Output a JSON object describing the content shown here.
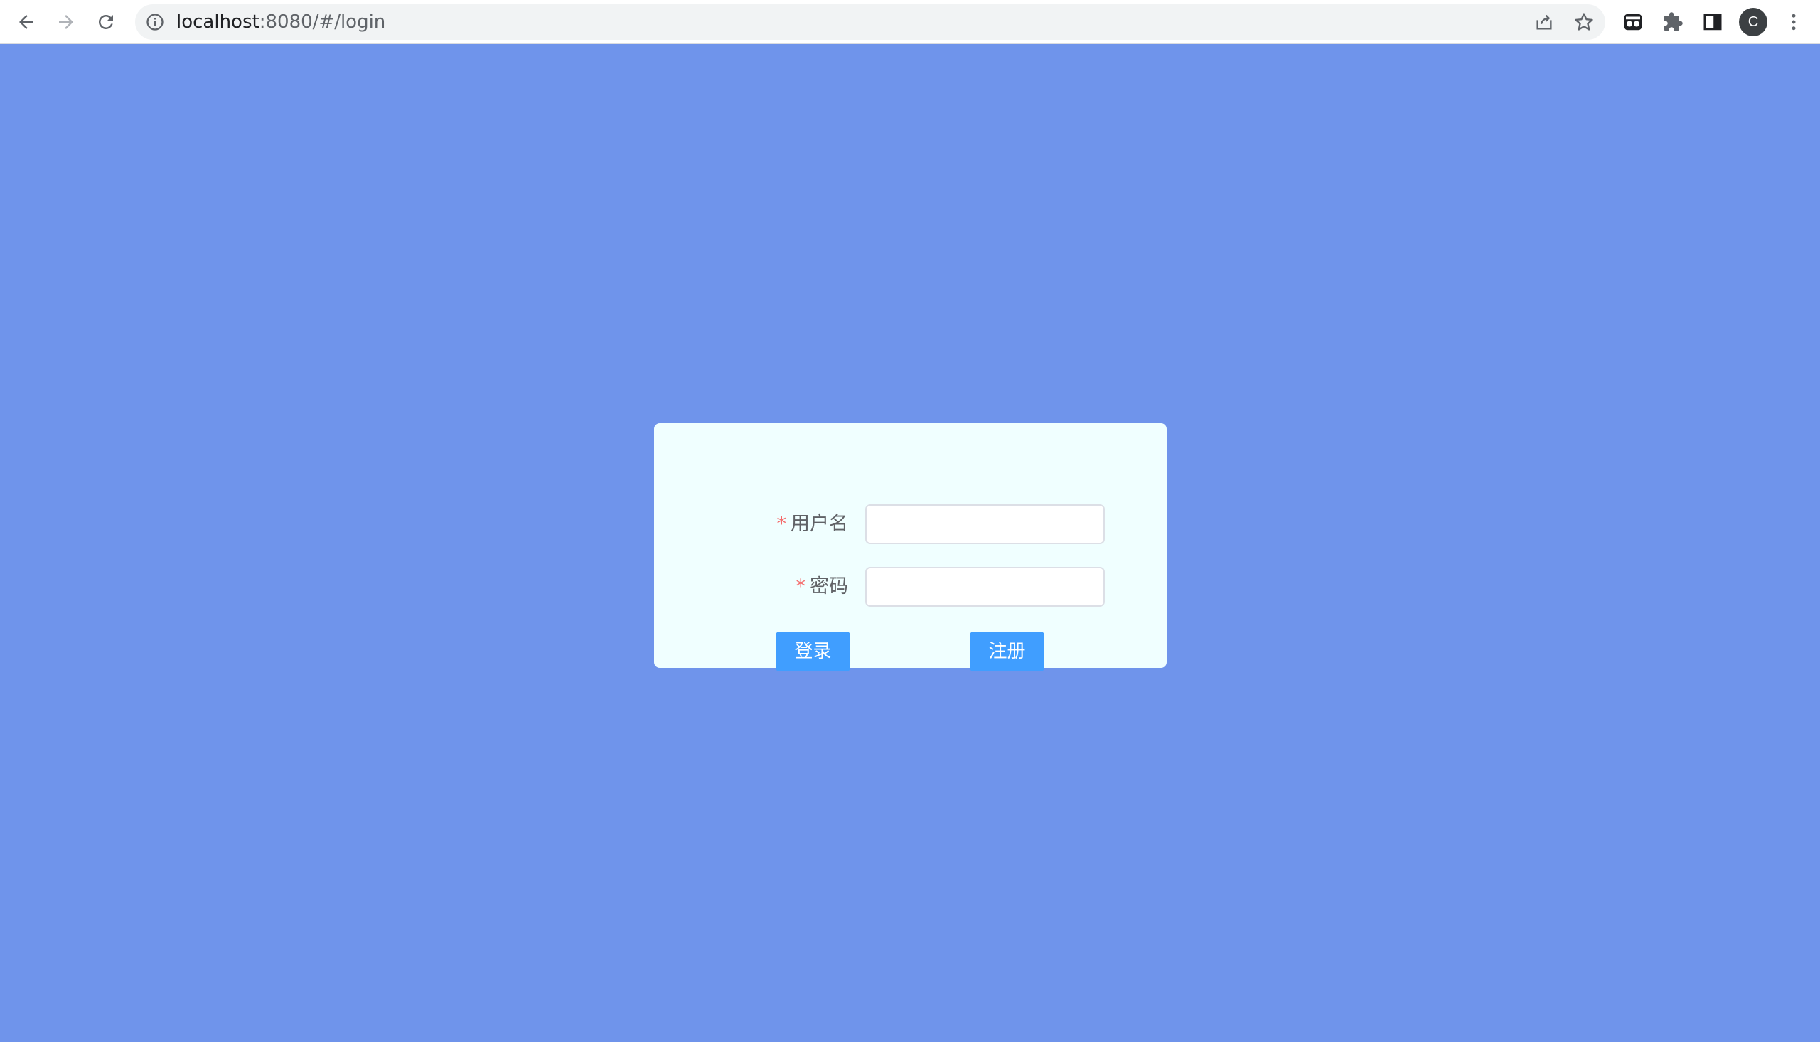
{
  "browser": {
    "url_host": "localhost",
    "url_path": ":8080/#/login",
    "profile_initial": "C",
    "icons": {
      "back": "back-arrow-icon",
      "forward": "forward-arrow-icon",
      "reload": "reload-icon",
      "info": "info-icon",
      "share": "share-icon",
      "bookmark": "star-icon",
      "extension_app": "extension-app-icon",
      "extensions": "puzzle-icon",
      "side_panel": "side-panel-icon",
      "menu": "kebab-menu-icon"
    }
  },
  "login_form": {
    "username_required_mark": "*",
    "username_label": "用户名",
    "username_value": "",
    "password_required_mark": "*",
    "password_label": "密码",
    "password_value": "",
    "login_button": "登录",
    "register_button": "注册"
  },
  "colors": {
    "page_background": "#6f94eb",
    "card_background": "#f0ffff",
    "primary_button": "#409eff",
    "required_star": "#f56c6c",
    "label_text": "#606266"
  }
}
